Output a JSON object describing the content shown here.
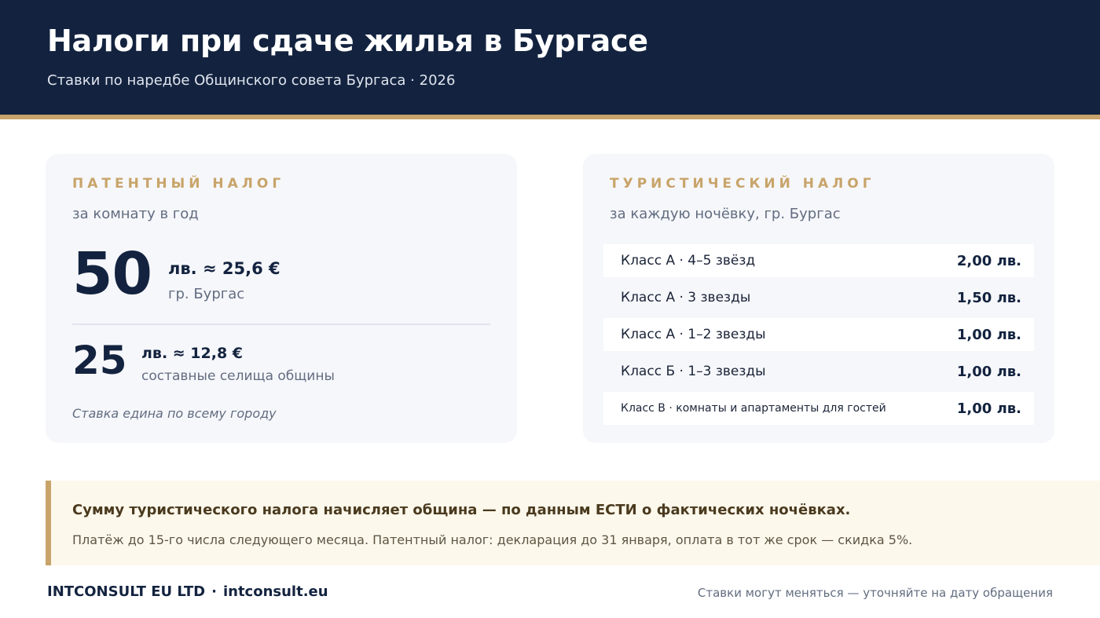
{
  "header": {
    "title": "Налоги при сдаче жилья в Бургасе",
    "subtitle": "Ставки по наредбе Общинского совета Бургаса · 2026"
  },
  "patent": {
    "label": "ПАТЕНТНЫЙ НАЛОГ",
    "sub": "за комнату в год",
    "main": {
      "value": "50",
      "unit": "лв.  ≈ 25,6 €",
      "place": "гр. Бургас"
    },
    "secondary": {
      "value": "25",
      "unit": "лв.  ≈ 12,8 €",
      "place": "составные селища общины"
    },
    "note": "Ставка едина по всему городу"
  },
  "tourist": {
    "label": "ТУРИСТИЧЕСКИЙ НАЛОГ",
    "sub": "за каждую ночёвку, гр. Бургас",
    "rows": [
      {
        "name": "Класс А · 4–5 звёзд",
        "value": "2,00 лв."
      },
      {
        "name": "Класс А · 3 звезды",
        "value": "1,50 лв."
      },
      {
        "name": "Класс А · 1–2 звезды",
        "value": "1,00 лв."
      },
      {
        "name": "Класс Б · 1–3 звезды",
        "value": "1,00 лв."
      },
      {
        "name": "Класс В · комнаты и апартаменты для гостей",
        "value": "1,00 лв."
      }
    ]
  },
  "callout": {
    "main": "Сумму туристического налога начисляет община — по данным ЕСТИ о фактических ночёвках.",
    "sub": "Платёж до 15-го числа следующего месяца.  Патентный налог: декларация до 31 января, оплата в тот же срок — скидка 5%."
  },
  "footer": {
    "company": "INTCONSULT EU LTD",
    "separator": "·",
    "site": "intconsult.eu",
    "disclaimer": "Ставки могут меняться — уточняйте на дату обращения"
  },
  "colors": {
    "navy": "#13233f",
    "gold": "#c8a46a",
    "card": "#f6f7fb",
    "callout": "#fdf8ec"
  }
}
